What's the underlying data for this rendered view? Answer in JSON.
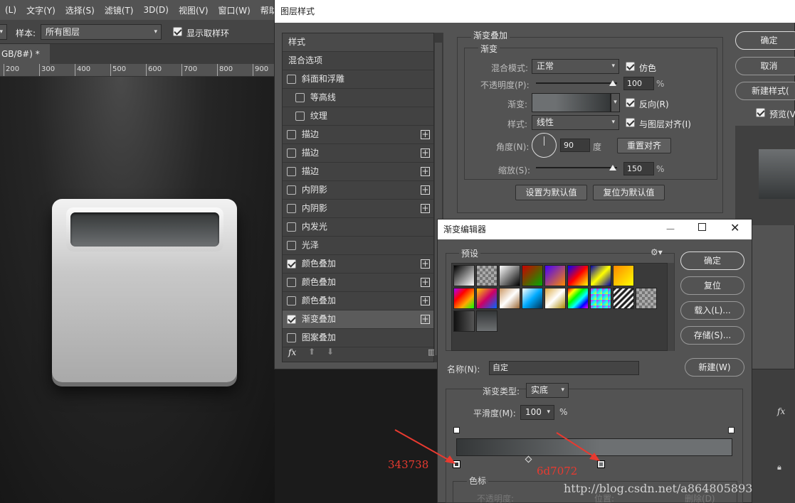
{
  "menubar": {
    "items": [
      "(L)",
      "文字(Y)",
      "选择(S)",
      "滤镜(T)",
      "3D(D)",
      "视图(V)",
      "窗口(W)",
      "帮助(H)"
    ]
  },
  "optbar": {
    "sample_label": "样本:",
    "sample_value": "所有图层",
    "show_ring_label": "显示取样环"
  },
  "doc_tab": {
    "label": "GB/8#) *",
    "close": "×"
  },
  "ruler": {
    "ticks": [
      "200",
      "300",
      "400",
      "500",
      "600",
      "700",
      "800",
      "900"
    ]
  },
  "layer_style": {
    "title": "图层样式",
    "list": [
      {
        "label": "样式",
        "checkbox": null,
        "plus": false
      },
      {
        "label": "混合选项",
        "checkbox": null,
        "plus": false
      },
      {
        "label": "斜面和浮雕",
        "checkbox": false,
        "plus": false
      },
      {
        "label": "等高线",
        "checkbox": false,
        "plus": false,
        "indent": true
      },
      {
        "label": "纹理",
        "checkbox": false,
        "plus": false,
        "indent": true
      },
      {
        "label": "描边",
        "checkbox": false,
        "plus": true
      },
      {
        "label": "描边",
        "checkbox": false,
        "plus": true
      },
      {
        "label": "描边",
        "checkbox": false,
        "plus": true
      },
      {
        "label": "内阴影",
        "checkbox": false,
        "plus": true
      },
      {
        "label": "内阴影",
        "checkbox": false,
        "plus": true
      },
      {
        "label": "内发光",
        "checkbox": false,
        "plus": false
      },
      {
        "label": "光泽",
        "checkbox": false,
        "plus": false
      },
      {
        "label": "颜色叠加",
        "checkbox": true,
        "plus": true
      },
      {
        "label": "颜色叠加",
        "checkbox": false,
        "plus": true
      },
      {
        "label": "颜色叠加",
        "checkbox": false,
        "plus": true
      },
      {
        "label": "渐变叠加",
        "checkbox": true,
        "plus": true,
        "selected": true
      },
      {
        "label": "图案叠加",
        "checkbox": false,
        "plus": false
      }
    ],
    "fx": "fx",
    "section_title": "渐变叠加",
    "sub_title": "渐变",
    "blend_mode_label": "混合模式:",
    "blend_mode_value": "正常",
    "dither_label": "仿色",
    "opacity_label": "不透明度(P):",
    "opacity_value": "100",
    "percent": "%",
    "gradient_label": "渐变:",
    "reverse_label": "反向(R)",
    "style_label": "样式:",
    "style_value": "线性",
    "align_label": "与图层对齐(I)",
    "angle_label": "角度(N):",
    "angle_value": "90",
    "degree": "度",
    "reset_align": "重置对齐",
    "scale_label": "缩放(S):",
    "scale_value": "150",
    "set_default": "设置为默认值",
    "reset_default": "复位为默认值",
    "ok": "确定",
    "cancel": "取消",
    "new_style": "新建样式(",
    "preview_label": "预览(V"
  },
  "gradient_editor": {
    "title": "渐变编辑器",
    "presets_label": "预设",
    "ok": "确定",
    "reset": "复位",
    "load": "载入(L)...",
    "save": "存储(S)...",
    "name_label": "名称(N):",
    "name_value": "自定",
    "new": "新建(W)",
    "type_label": "渐变类型:",
    "type_value": "实底",
    "smooth_label": "平滑度(M):",
    "smooth_value": "100",
    "percent": "%",
    "color_stop_label": "色标",
    "opacity_label": "不透明度:",
    "location_label": "位置:",
    "delete_label": "删除(D)",
    "stop_left_color": "#343738",
    "stop_right_color": "#6d7072"
  },
  "annotations": {
    "left": "343738",
    "right": "6d7072",
    "watermark": "http://blog.csdn.net/a864805893"
  },
  "right_panel": {
    "fx": "fx"
  }
}
